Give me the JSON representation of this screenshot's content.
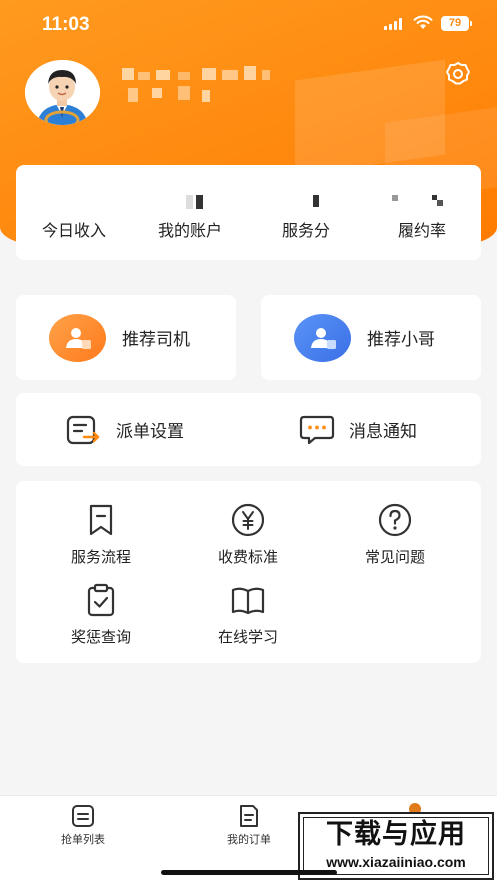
{
  "status_bar": {
    "time": "11:03",
    "battery": "79"
  },
  "stats": [
    {
      "label": "今日收入"
    },
    {
      "label": "我的账户"
    },
    {
      "label": "服务分"
    },
    {
      "label": "履约率"
    }
  ],
  "recommend": {
    "driver_label": "推荐司机",
    "courier_label": "推荐小哥"
  },
  "functions": {
    "dispatch_label": "派单设置",
    "messages_label": "消息通知"
  },
  "grid": [
    {
      "label": "服务流程",
      "icon": "bookmark-icon"
    },
    {
      "label": "收费标准",
      "icon": "yen-icon"
    },
    {
      "label": "常见问题",
      "icon": "question-icon"
    },
    {
      "label": "奖惩查询",
      "icon": "clipboard-check-icon"
    },
    {
      "label": "在线学习",
      "icon": "book-icon"
    }
  ],
  "tabs": [
    {
      "label": "抢单列表"
    },
    {
      "label": "我的订单"
    }
  ],
  "watermark": {
    "title": "下载与应用",
    "url": "www.xiazaiiniao.com"
  },
  "colors": {
    "brand_orange": "#ff8a10",
    "driver_icon": "#ff8a2a",
    "courier_icon": "#3f7cf2"
  }
}
